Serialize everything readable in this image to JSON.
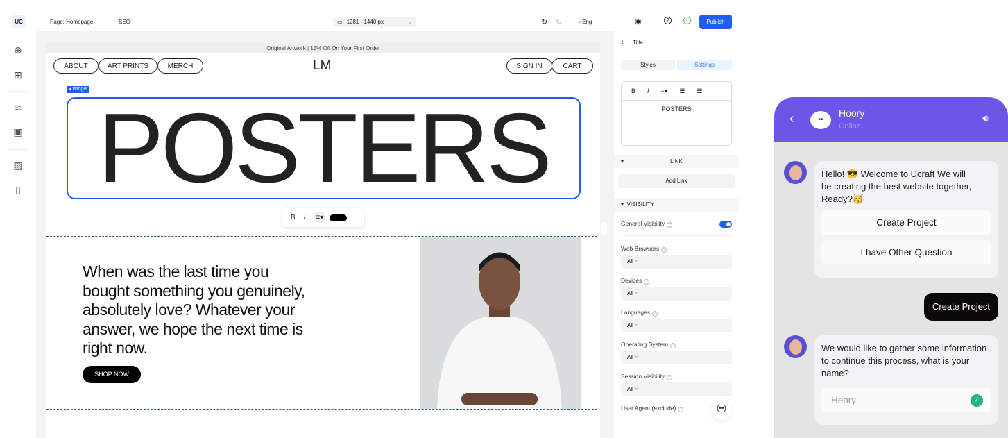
{
  "topbar": {
    "logo": "UC",
    "page": "Page: Homepage",
    "seo": "SEO",
    "viewport": "1281 - 1440 px",
    "language": "Eng",
    "publish": "Publish"
  },
  "site": {
    "promo": "Original Artwork | 15% Off On Your First Order",
    "nav_left": [
      "ABOUT",
      "ART PRINTS",
      "MERCH"
    ],
    "logo": "LM",
    "nav_right": [
      "SIGN IN",
      "CART"
    ],
    "widget_tag": "Widget",
    "title": "POSTERS",
    "body": "When was the last time you bought something you genuinely, absolutely love? Whatever your answer, we hope the next time is right now.",
    "cta": "SHOP NOW"
  },
  "format_toolbar": {
    "bold": "B",
    "italic": "I",
    "color": "#000000"
  },
  "panel": {
    "back_title": "Title",
    "tabs": [
      "Styles",
      "Settings"
    ],
    "active_tab": "Settings",
    "editor_text": "POSTERS",
    "link_section": "LINK",
    "add_link": "Add Link",
    "visibility_section": "VISIBILITY",
    "general_visibility": "General Visibility",
    "general_visibility_on": true,
    "fields": [
      {
        "label": "Web Browsers",
        "value": "All"
      },
      {
        "label": "Devices",
        "value": "All"
      },
      {
        "label": "Languages",
        "value": "All"
      },
      {
        "label": "Operating System",
        "value": "All"
      },
      {
        "label": "Session Visibility",
        "value": "All"
      }
    ],
    "user_agent": "User Agent (exclude)"
  },
  "chat": {
    "name": "Hoory",
    "status": "Online",
    "accent": "#6c56e8",
    "msg1": "Hello! 😎 Welcome to Ucraft We will be creating the best website together, Ready?🥳",
    "options": [
      "Create Project",
      "I have Other Question"
    ],
    "user_reply": "Create Project",
    "msg2": "We would like to gather some information to continue this process, what is your name?",
    "name_input": "Henry"
  }
}
